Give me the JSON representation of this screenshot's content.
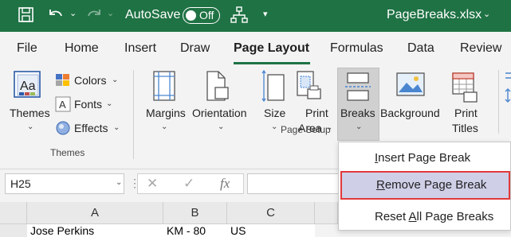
{
  "titlebar": {
    "autosave_label": "AutoSave",
    "autosave_state": "Off",
    "filename": "PageBreaks.xlsx",
    "bg_color": "#1f7244"
  },
  "tabs": [
    {
      "label": "File"
    },
    {
      "label": "Home"
    },
    {
      "label": "Insert"
    },
    {
      "label": "Draw"
    },
    {
      "label": "Page Layout",
      "active": true
    },
    {
      "label": "Formulas"
    },
    {
      "label": "Data"
    },
    {
      "label": "Review"
    }
  ],
  "ribbon": {
    "themes_group": {
      "themes_label": "Themes",
      "colors_label": "Colors",
      "fonts_label": "Fonts",
      "effects_label": "Effects",
      "group_label": "Themes"
    },
    "page_setup_group": {
      "margins_label": "Margins",
      "orientation_label": "Orientation",
      "size_label": "Size",
      "print_area_line1": "Print",
      "print_area_line2": "Area",
      "breaks_label": "Breaks",
      "background_label": "Background",
      "print_titles_line1": "Print",
      "print_titles_line2": "Titles",
      "group_label": "Page Setup"
    }
  },
  "formula_bar": {
    "name_box": "H25",
    "fx_symbol": "fx",
    "cancel_symbol": "✕",
    "enter_symbol": "✓"
  },
  "columns": [
    "A",
    "B",
    "C"
  ],
  "row_partial": [
    "Jose Perkins",
    "KM - 80",
    "US"
  ],
  "breaks_menu": {
    "insert_prefix": "",
    "insert_hotkey": "I",
    "insert_rest": "nsert Page Break",
    "remove_hotkey": "R",
    "remove_rest": "emove Page Break",
    "reset_prefix": "Reset ",
    "reset_hotkey": "A",
    "reset_rest": "ll Page Breaks"
  },
  "colors": {
    "accent": "#1f7244",
    "highlight_border": "#e03a3a",
    "highlight_bg": "#cfcfe8"
  }
}
